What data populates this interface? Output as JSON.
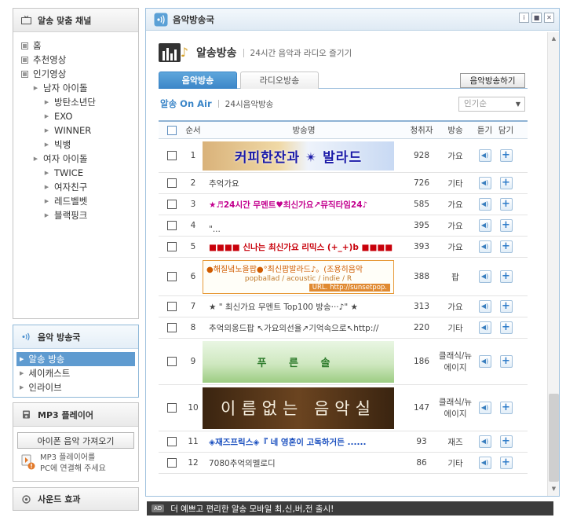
{
  "sidebar": {
    "channel_title": "알송 맞춤 채널",
    "tree": [
      {
        "label": "홈",
        "type": "box",
        "level": 1
      },
      {
        "label": "추천영상",
        "type": "box",
        "level": 1
      },
      {
        "label": "인기영상",
        "type": "box",
        "level": 1
      },
      {
        "label": "남자 아이돌",
        "type": "arrow",
        "level": 2
      },
      {
        "label": "방탄소년단",
        "type": "arrow",
        "level": 3
      },
      {
        "label": "EXO",
        "type": "arrow",
        "level": 3
      },
      {
        "label": "WINNER",
        "type": "arrow",
        "level": 3
      },
      {
        "label": "빅뱅",
        "type": "arrow",
        "level": 3
      },
      {
        "label": "여자 아이돌",
        "type": "arrow",
        "level": 2
      },
      {
        "label": "TWICE",
        "type": "arrow",
        "level": 3
      },
      {
        "label": "여자친구",
        "type": "arrow",
        "level": 3
      },
      {
        "label": "레드벨벳",
        "type": "arrow",
        "level": 3
      },
      {
        "label": "블랙핑크",
        "type": "arrow",
        "level": 3
      }
    ],
    "radio_title": "음악 방송국",
    "radio_items": [
      {
        "label": "알송 방송",
        "selected": true
      },
      {
        "label": "세이캐스트",
        "selected": false
      },
      {
        "label": "인라이브",
        "selected": false
      }
    ],
    "mp3_title": "MP3 플레이어",
    "mp3_button": "아이폰 음악 가져오기",
    "mp3_note_line1": "MP3 플레이어를",
    "mp3_note_line2": "PC에 연결해 주세요",
    "sound_title": "사운드 효과"
  },
  "main": {
    "window_title": "음악방송국",
    "window_controls": [
      "i",
      "■",
      "✕"
    ],
    "heading": "알송방송",
    "heading_sub": "24시간 음악과 라디오 즐기기",
    "tabs": [
      {
        "label": "음악방송",
        "active": true
      },
      {
        "label": "라디오방송",
        "active": false
      }
    ],
    "listen_button": "음악방송하기",
    "section_title": "알송 On Air",
    "section_desc": "24시음악방송",
    "sort_value": "인기순",
    "columns": {
      "no": "순서",
      "name": "방송명",
      "listeners": "청취자",
      "genre": "방송",
      "play": "듣기",
      "add": "담기"
    },
    "rows": [
      {
        "no": "1",
        "kind": "banner",
        "banner": "b1",
        "text": "커피한잔과 ✴ 발라드",
        "listeners": "928",
        "genre": "가요"
      },
      {
        "no": "2",
        "kind": "text",
        "text": "추억가요",
        "listeners": "726",
        "genre": "기타"
      },
      {
        "no": "3",
        "kind": "text",
        "style": "t-mag",
        "text": "★♬24시간 무멘트♥최신가요↗뮤직타임24♪",
        "listeners": "585",
        "genre": "가요"
      },
      {
        "no": "4",
        "kind": "text",
        "text": "\"...",
        "listeners": "395",
        "genre": "가요"
      },
      {
        "no": "5",
        "kind": "text",
        "style": "t-red",
        "text": "■■■■ 신나는 최신가요 리믹스 (+_+)b ■■■■",
        "listeners": "393",
        "genre": "가요"
      },
      {
        "no": "6",
        "kind": "banner6",
        "line1": "●해질녘노을팝●°최신팝발라드♪。(조용히음악",
        "line2": "popballad / acoustic / indie / R",
        "line3": "URL. http://sunsetpop.",
        "listeners": "388",
        "genre": "팝"
      },
      {
        "no": "7",
        "kind": "text",
        "text": "★ \" 최신가요 무멘트 Top100 방송···♪\" ★",
        "listeners": "313",
        "genre": "가요"
      },
      {
        "no": "8",
        "kind": "text",
        "text": "추억의옹드팝 ↖가요의선율↗기억속으로↖http://",
        "listeners": "220",
        "genre": "기타"
      },
      {
        "no": "9",
        "kind": "banner",
        "banner": "b9",
        "text": "푸 른 솔",
        "listeners": "186",
        "genre": "클래식/뉴에이지"
      },
      {
        "no": "10",
        "kind": "banner",
        "banner": "b10",
        "text": "이름없는 음악실",
        "listeners": "147",
        "genre": "클래식/뉴에이지"
      },
      {
        "no": "11",
        "kind": "text",
        "style": "t-blue",
        "text": "◈재즈프릭스◈『 네 영혼이 고독하거든 ......",
        "listeners": "93",
        "genre": "재즈"
      },
      {
        "no": "12",
        "kind": "text",
        "text": "7080추억의멜로디",
        "listeners": "86",
        "genre": "기타"
      }
    ]
  },
  "notice": {
    "badge": "AD",
    "text": "더 예쁘고 편리한 알송 모바일 최,신,버,전 출시!"
  }
}
